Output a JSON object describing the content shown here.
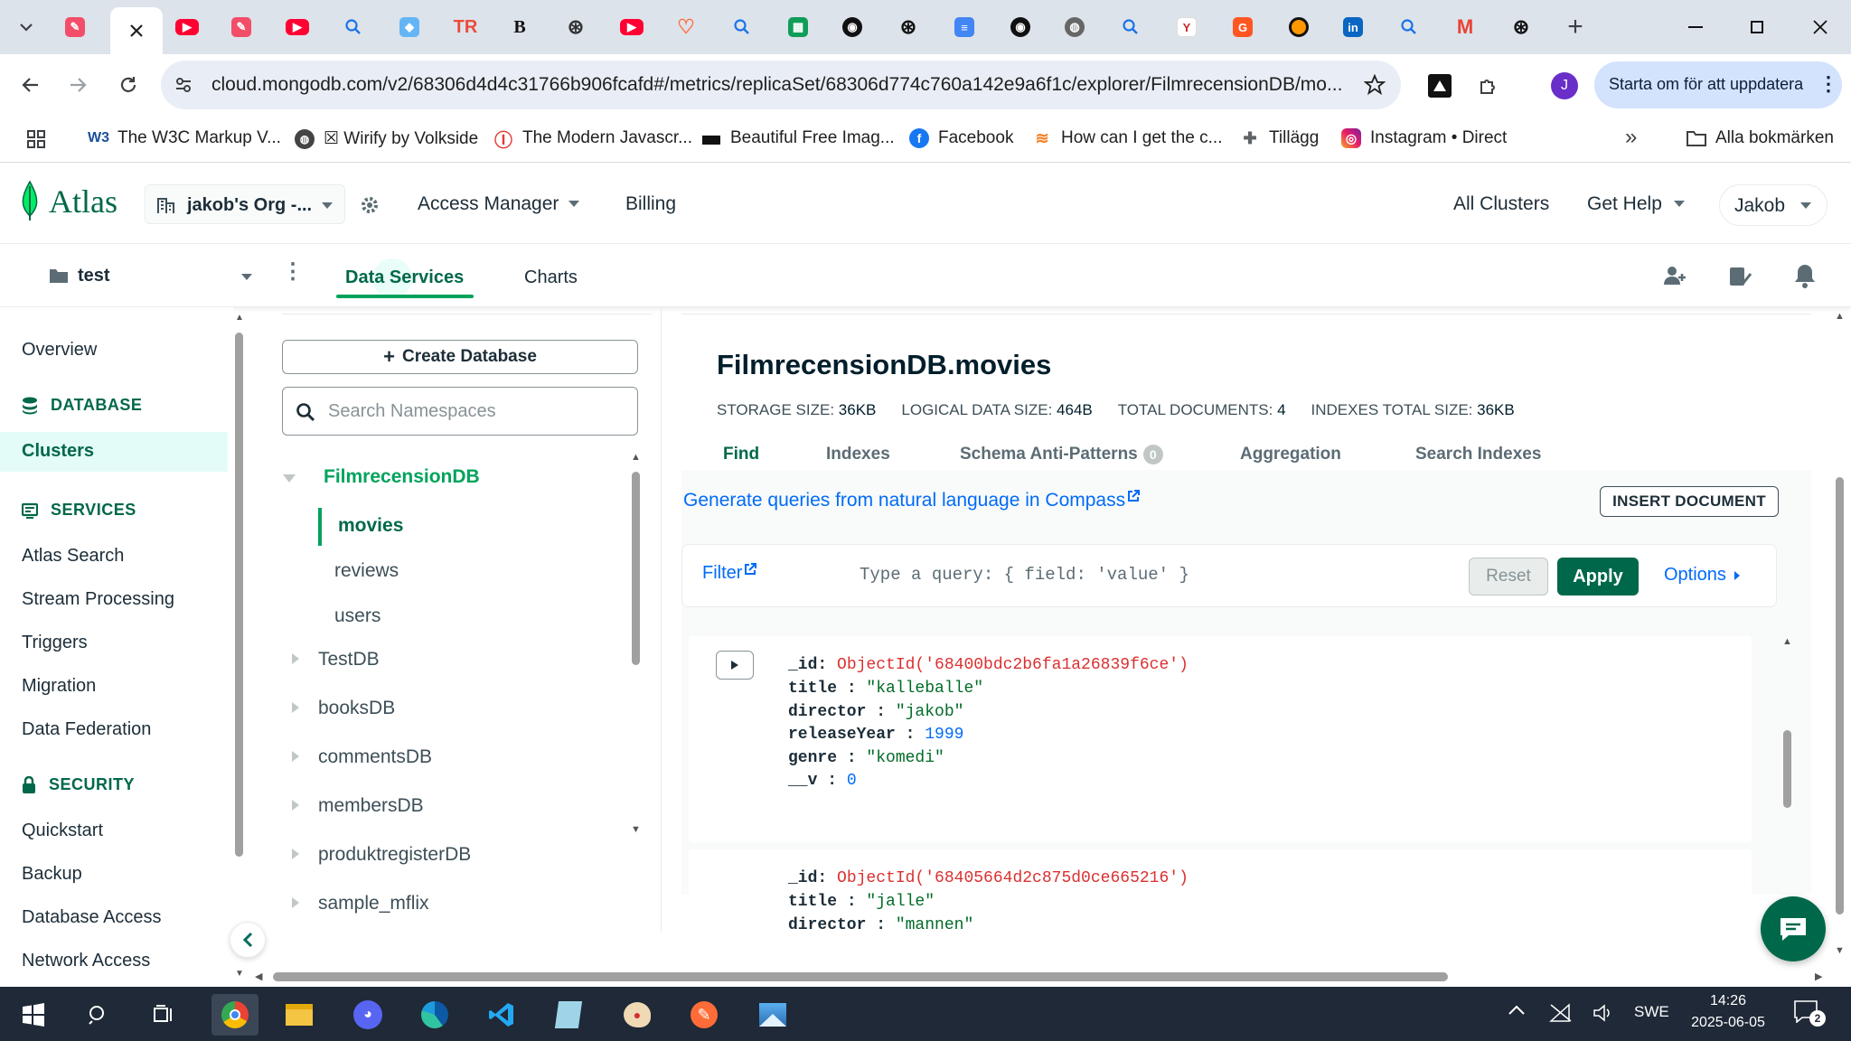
{
  "browser": {
    "tabs": [
      {
        "icon": "dropdown-icon",
        "color": "#dde3ea"
      },
      {
        "icon": "figma-like-icon",
        "color": "#f24e6a"
      },
      {
        "icon": "close-icon",
        "color": "#ffffff",
        "active": true
      },
      {
        "icon": "youtube-icon",
        "color": "#ff0033"
      },
      {
        "icon": "pen-icon",
        "color": "#f24e6a"
      },
      {
        "icon": "youtube-icon",
        "color": "#ff0033"
      },
      {
        "icon": "search-icon",
        "color": "#1a73e8"
      },
      {
        "icon": "shape-icon",
        "color": "#2196f3"
      },
      {
        "icon": "tr-icon",
        "color": "#e94c3d"
      },
      {
        "icon": "b-icon",
        "color": "#111111"
      },
      {
        "icon": "openai-icon",
        "color": "#333333"
      },
      {
        "icon": "youtube-icon",
        "color": "#ff0033"
      },
      {
        "icon": "pin-icon",
        "color": "#ff7043"
      },
      {
        "icon": "search-icon",
        "color": "#1a73e8"
      },
      {
        "icon": "sheet-icon",
        "color": "#0f9d58"
      },
      {
        "icon": "github-icon",
        "color": "#111111"
      },
      {
        "icon": "openai-icon",
        "color": "#111111"
      },
      {
        "icon": "docs-icon",
        "color": "#4285f4"
      },
      {
        "icon": "github-icon",
        "color": "#111111"
      },
      {
        "icon": "globe-icon",
        "color": "#555555"
      },
      {
        "icon": "search-icon",
        "color": "#1a73e8"
      },
      {
        "icon": "y-icon",
        "color": "#c62828"
      },
      {
        "icon": "g-icon",
        "color": "#ff5722"
      },
      {
        "icon": "avatar-icon",
        "color": "#ff9800"
      },
      {
        "icon": "linkedin-icon",
        "color": "#0a66c2"
      },
      {
        "icon": "search-icon",
        "color": "#1a73e8"
      },
      {
        "icon": "gmail-icon",
        "color": "#ea4335"
      },
      {
        "icon": "openai-icon",
        "color": "#111111"
      }
    ],
    "new_tab": "+",
    "url": "cloud.mongodb.com/v2/68306d4d4c31766b906fcafd#/metrics/replicaSet/68306d774c760a142e9a6f1c/explorer/FilmrecensionDB/mo...",
    "profile_initial": "J",
    "update_label": "Starta om för att uppdatera",
    "bookmarks": [
      {
        "label": "The W3C Markup V...",
        "icon": "w3c-icon"
      },
      {
        "label": "☒ Wirify by Volkside",
        "icon": "globe-icon"
      },
      {
        "label": "The Modern Javascr...",
        "icon": "js-icon"
      },
      {
        "label": "Beautiful Free Imag...",
        "icon": "unsplash-icon"
      },
      {
        "label": "Facebook",
        "icon": "facebook-icon"
      },
      {
        "label": "How can I get the c...",
        "icon": "stackoverflow-icon"
      },
      {
        "label": "Tillägg",
        "icon": "puzzle-icon"
      },
      {
        "label": "Instagram • Direct",
        "icon": "instagram-icon"
      }
    ],
    "all_bookmarks": "Alla bokmärken"
  },
  "atlas": {
    "logo": "Atlas",
    "org": "jakob's Org -...",
    "access_manager": "Access Manager",
    "billing": "Billing",
    "all_clusters": "All Clusters",
    "get_help": "Get Help",
    "user": "Jakob",
    "project": "test",
    "tabs": [
      "Data Services",
      "Charts"
    ]
  },
  "sidebar": {
    "overview": "Overview",
    "database_header": "DATABASE",
    "clusters": "Clusters",
    "services_header": "SERVICES",
    "services": [
      "Atlas Search",
      "Stream Processing",
      "Triggers",
      "Migration",
      "Data Federation"
    ],
    "security_header": "SECURITY",
    "security": [
      "Quickstart",
      "Backup",
      "Database Access",
      "Network Access"
    ]
  },
  "namespaces": {
    "create_db": "Create Database",
    "search_placeholder": "Search Namespaces",
    "active_db": "FilmrecensionDB",
    "collections": [
      "movies",
      "reviews",
      "users"
    ],
    "databases": [
      "TestDB",
      "booksDB",
      "commentsDB",
      "membersDB",
      "produktregisterDB",
      "sample_mflix"
    ]
  },
  "collection": {
    "title": "FilmrecensionDB.movies",
    "stats": [
      {
        "label": "STORAGE SIZE:",
        "value": "36KB"
      },
      {
        "label": "LOGICAL DATA SIZE:",
        "value": "464B"
      },
      {
        "label": "TOTAL DOCUMENTS:",
        "value": "4"
      },
      {
        "label": "INDEXES TOTAL SIZE:",
        "value": "36KB"
      }
    ],
    "tabs": [
      "Find",
      "Indexes",
      "Schema Anti-Patterns",
      "Aggregation",
      "Search Indexes"
    ],
    "anti_pattern_count": "0",
    "compass_link": "Generate queries from natural language in Compass",
    "insert_document": "INSERT DOCUMENT",
    "filter_label": "Filter",
    "query_placeholder": "Type a query: { field: 'value' }",
    "reset": "Reset",
    "apply": "Apply",
    "options": "Options"
  },
  "documents": [
    {
      "id": "ObjectId('68400bdc2b6fa1a26839f6ce')",
      "title": "\"kalleballe\"",
      "director": "\"jakob\"",
      "releaseYear": "1999",
      "genre": "\"komedi\"",
      "v": "0"
    },
    {
      "id": "ObjectId('68405664d2c875d0ce665216')",
      "title": "\"jalle\"",
      "director": "\"mannen\""
    }
  ],
  "field_keys": {
    "id": "_id",
    "title": "title",
    "director": "director",
    "releaseYear": "releaseYear",
    "genre": "genre",
    "v": "__v"
  },
  "taskbar": {
    "language": "SWE",
    "time": "14:26",
    "date": "2025-06-05",
    "notifications": "2"
  }
}
